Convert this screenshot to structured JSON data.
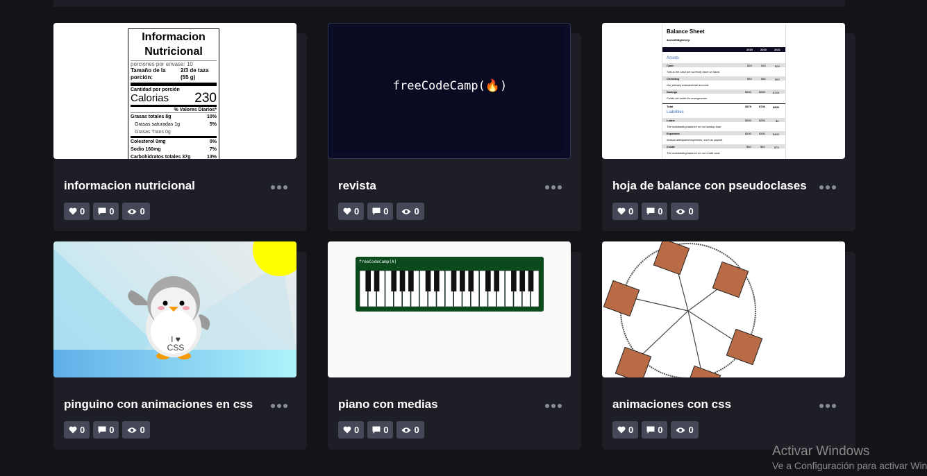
{
  "cards": [
    {
      "title": "informacion nutricional",
      "likes": "0",
      "comments": "0",
      "views": "0"
    },
    {
      "title": "revista",
      "likes": "0",
      "comments": "0",
      "views": "0"
    },
    {
      "title": "hoja de balance con pseudoclases",
      "likes": "0",
      "comments": "0",
      "views": "0"
    },
    {
      "title": "pinguino con animaciones en css",
      "likes": "0",
      "comments": "0",
      "views": "0"
    },
    {
      "title": "piano con medias",
      "likes": "0",
      "comments": "0",
      "views": "0"
    },
    {
      "title": "animaciones con css",
      "likes": "0",
      "comments": "0",
      "views": "0"
    }
  ],
  "previews": {
    "nutrition": {
      "title1": "Informacion",
      "title2": "Nutricional",
      "servings": "porciones por envase: 10",
      "size_label": "Tamaño de la porción:",
      "size_value": "2/3 de taza (55 g)",
      "amount": "Cantidad por porción",
      "calories_label": "Calorias",
      "calories_value": "230",
      "daily": "% Valores Diarios*",
      "fat": "Grasas totales 8g",
      "fat_pct": "10%",
      "sat": "Grasas saturadas 1g",
      "sat_pct": "5%",
      "trans": "Grasas Trans 0g",
      "chol": "Colesterol 0mg",
      "chol_pct": "0%",
      "sodium": "Sodio 160mg",
      "sodium_pct": "7%",
      "carbs": "Carbohidratos totales 37g",
      "carbs_pct": "13%"
    },
    "magazine": {
      "logo": "freeCodeCamp(🔥)"
    },
    "balance": {
      "title": "Balance Sheet",
      "company": "AcmeWidgetCorp",
      "years": [
        "2019",
        "2020",
        "2021"
      ],
      "assets": "Assets",
      "liabilities": "Liabilities",
      "cash": "Cash",
      "cash_vals": [
        "$25",
        "$30",
        "$28"
      ],
      "cash_note": "This is the cash we currently have on hand.",
      "checking": "Checking",
      "checking_vals": [
        "$54",
        "$56",
        "$53"
      ],
      "checking_note": "Our primary transactional account.",
      "savings": "Savings",
      "savings_vals": [
        "$500",
        "$650",
        "$728"
      ],
      "savings_note": "Funds set aside for emergencies.",
      "total": "Total",
      "total_vals": [
        "$579",
        "$736",
        "$809"
      ],
      "loans": "Loans",
      "loans_vals": [
        "$500",
        "$250",
        "$0"
      ],
      "loans_note": "The outstanding balance on our startup loan.",
      "expenses": "Expenses",
      "expenses_vals": [
        "$200",
        "$300",
        "$400"
      ],
      "expenses_note": "Annual anticipated expenses, such as payroll.",
      "credit": "Credit",
      "credit_vals": [
        "$50",
        "$50",
        "$75"
      ],
      "credit_note": "The outstanding balance on our credit card."
    },
    "penguin": {
      "shirt_line1": "I ♥",
      "shirt_line2": "CSS"
    },
    "piano": {
      "logo": "freeCodeCamp(A)"
    }
  },
  "watermark": {
    "line1": "Activar Windows",
    "line2": "Ve a Configuración para activar Windows."
  },
  "colors": {
    "bg": "#131417",
    "card": "#1e1f26",
    "stat": "#444857",
    "sun": "#ffff00",
    "piano": "#0b4a1c",
    "cabin": "#b86b45"
  }
}
